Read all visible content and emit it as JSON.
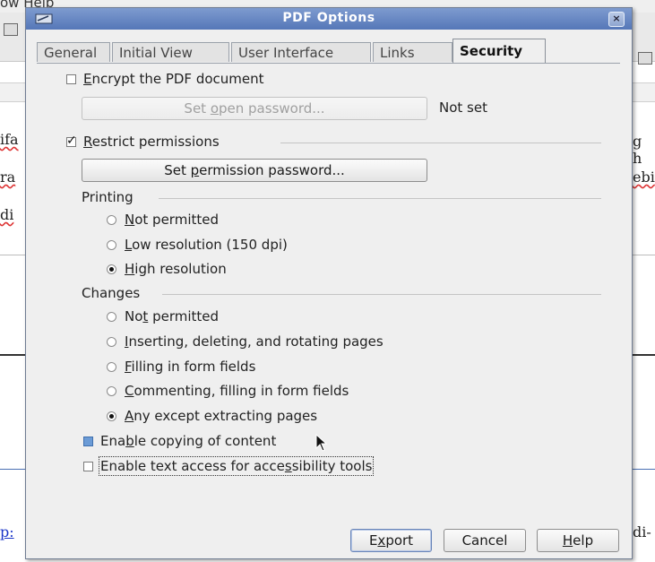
{
  "background": {
    "menu_fragment": "ow   Help",
    "fragments": {
      "left_1": "ifa",
      "left_2": "ra",
      "left_3": "di",
      "left_link": "p:",
      "right_1": "g h",
      "right_2": "ebi",
      "right_3": "di-"
    }
  },
  "dialog": {
    "title": "PDF Options",
    "close_glyph": "×",
    "tabs": [
      {
        "label": "General"
      },
      {
        "label": "Initial View"
      },
      {
        "label": "User Interface"
      },
      {
        "label": "Links"
      },
      {
        "label": "Security",
        "active": true
      }
    ],
    "security": {
      "encrypt": {
        "pre": "",
        "mn": "E",
        "post": "ncrypt the PDF document",
        "checked": false
      },
      "set_open_password": {
        "pre": "Set ",
        "mn": "o",
        "post": "pen password...",
        "enabled": false
      },
      "open_password_status": "Not set",
      "restrict": {
        "pre": "",
        "mn": "R",
        "post": "estrict permissions",
        "checked": true
      },
      "set_permission_password": {
        "pre": "Set ",
        "mn": "p",
        "post": "ermission password..."
      },
      "printing": {
        "label": "Printing",
        "options": [
          {
            "pre": "",
            "mn": "N",
            "post": "ot permitted",
            "checked": false
          },
          {
            "pre": "",
            "mn": "L",
            "post": "ow resolution (150 dpi)",
            "checked": false
          },
          {
            "pre": "",
            "mn": "H",
            "post": "igh resolution",
            "checked": true
          }
        ]
      },
      "changes": {
        "label": "Changes",
        "options": [
          {
            "pre": "No",
            "mn": "t",
            "post": " permitted",
            "checked": false
          },
          {
            "pre": "",
            "mn": "I",
            "post": "nserting, deleting, and rotating pages",
            "checked": false
          },
          {
            "pre": "",
            "mn": "F",
            "post": "illing in form fields",
            "checked": false
          },
          {
            "pre": "",
            "mn": "C",
            "post": "ommenting, filling in form fields",
            "checked": false
          },
          {
            "pre": "",
            "mn": "A",
            "post": "ny except extracting pages",
            "checked": true
          }
        ]
      },
      "copy_content": {
        "pre": "Ena",
        "mn": "b",
        "post": "le copying of content",
        "checked": false
      },
      "accessibility": {
        "pre": "Enable text access for acce",
        "mn": "s",
        "post": "sibility tools",
        "checked": false
      }
    },
    "buttons": {
      "export": {
        "pre": "E",
        "mn": "x",
        "post": "port"
      },
      "cancel": {
        "pre": "Cancel",
        "mn": "",
        "post": ""
      },
      "help": {
        "pre": "",
        "mn": "H",
        "post": "elp"
      }
    }
  },
  "colors": {
    "titlebar": "#5577b8",
    "dialog_bg": "#efefef",
    "checkbox_highlight": "#6b9bd6"
  }
}
